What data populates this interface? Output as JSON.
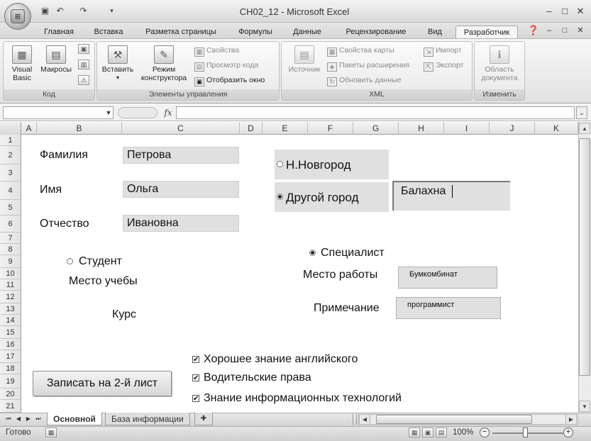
{
  "window": {
    "title": "CH02_12 - Microsoft Excel",
    "controls": [
      "–",
      "□",
      "✕"
    ],
    "inner_controls": [
      "–",
      "□",
      "✕"
    ]
  },
  "ribbon_tabs": [
    "Главная",
    "Вставка",
    "Разметка страницы",
    "Формулы",
    "Данные",
    "Рецензирование",
    "Вид",
    "Разработчик"
  ],
  "active_tab": "Разработчик",
  "ribbon": {
    "code_group": {
      "label": "Код",
      "visual_basic": "Visual Basic",
      "visual_basic_line1": "Visual",
      "visual_basic_line2": "Basic",
      "macros": "Макросы"
    },
    "controls_group": {
      "label": "Элементы управления",
      "insert": "Вставить",
      "design_mode_line1": "Режим",
      "design_mode_line2": "конструктора",
      "properties": "Свойства",
      "view_code": "Просмотр кода",
      "show_window": "Отобразить окно"
    },
    "xml_group": {
      "label": "XML",
      "source": "Источник",
      "map_properties": "Свойства карты",
      "expansion_packs": "Пакеты расширения",
      "refresh_data": "Обновить данные",
      "import": "Импорт",
      "export": "Экспорт"
    },
    "modify_group": {
      "label": "Изменить",
      "doc_panel_line1": "Область",
      "doc_panel_line2": "документа"
    }
  },
  "formula_bar": {
    "fx": "fx",
    "name_box_value": "",
    "formula_value": ""
  },
  "columns": [
    "A",
    "B",
    "C",
    "D",
    "E",
    "F",
    "G",
    "H",
    "I",
    "J",
    "K"
  ],
  "rows": [
    "1",
    "2",
    "3",
    "4",
    "5",
    "6",
    "7",
    "8",
    "9",
    "10",
    "11",
    "12",
    "13",
    "14",
    "15",
    "16",
    "17",
    "18",
    "19",
    "20",
    "21"
  ],
  "form": {
    "surname_label": "Фамилия",
    "surname_value": "Петрова",
    "name_label": "Имя",
    "name_value": "Ольга",
    "patronymic_label": "Отчество",
    "patronymic_value": "Ивановна",
    "city_option_1": "Н.Новгород",
    "city_option_2": "Другой город",
    "city_option_2_selected": true,
    "other_city_value": "Балахна",
    "student_label": "Студент",
    "study_place_label": "Место учебы",
    "course_label": "Курс",
    "specialist_label": "Специалист",
    "specialist_selected": true,
    "work_place_label": "Место работы",
    "work_place_value": "Бумкомбинат",
    "note_label": "Примечание",
    "note_value": "программист",
    "check_english": "Хорошее знание английского",
    "check_license": "Водительские права",
    "check_it": "Знание информационных технологий",
    "check_mark": "✔",
    "write_button": "Записать на 2-й лист"
  },
  "sheet_tabs": [
    "Основной",
    "База информации"
  ],
  "active_sheet": "Основной",
  "status": {
    "ready": "Готово",
    "zoom": "100%",
    "zoom_minus": "−",
    "zoom_plus": "+"
  }
}
